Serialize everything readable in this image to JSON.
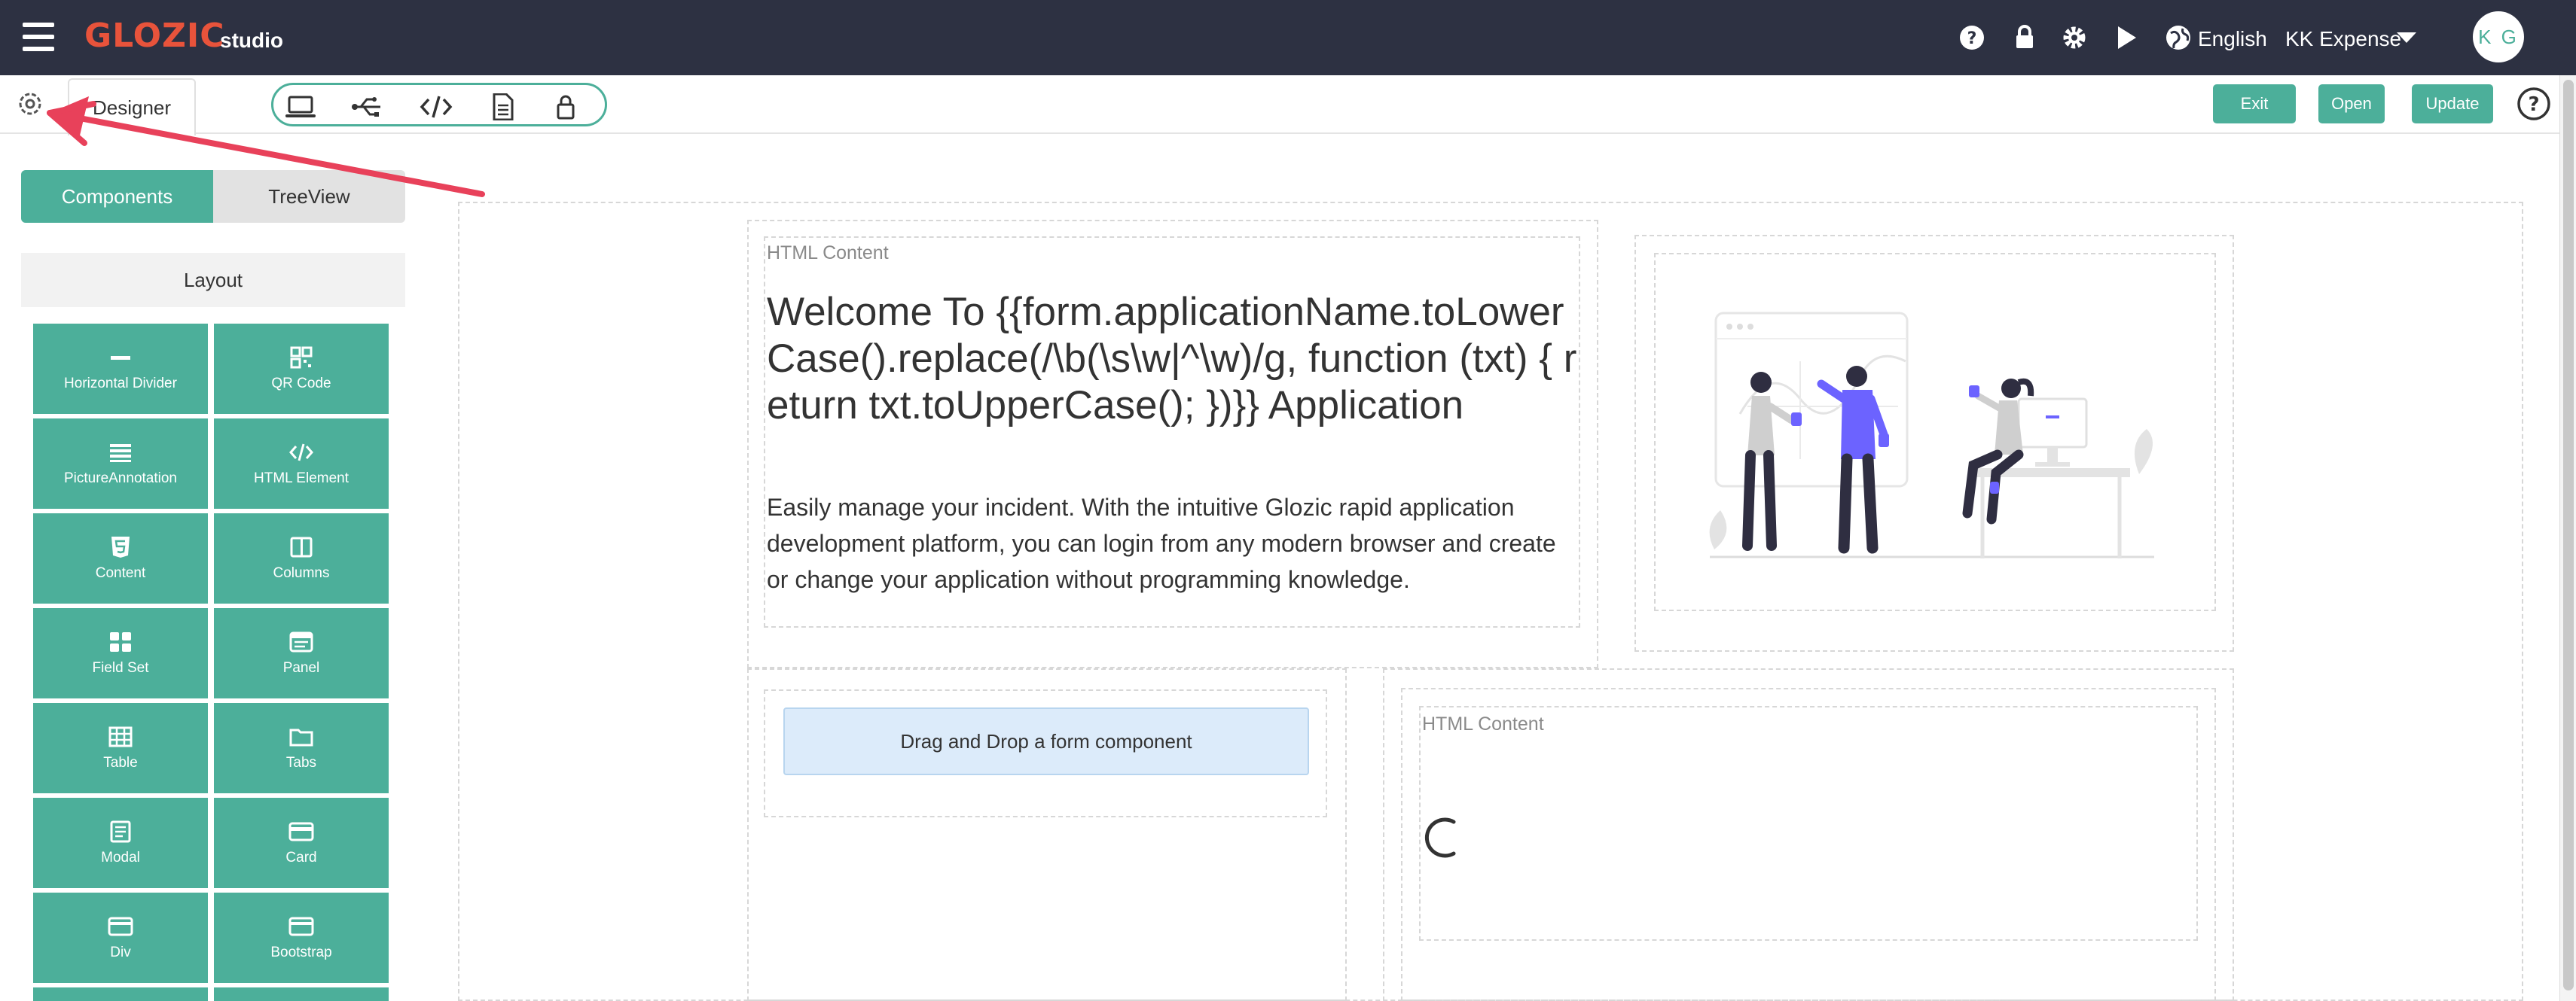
{
  "app": {
    "logo_text": "GLOZIC",
    "logo_sub": "studio",
    "language": "English",
    "application": "KK Expense",
    "user_initials": "K G"
  },
  "toolbar": {
    "designer_tab": "Designer",
    "exit_label": "Exit",
    "open_label": "Open",
    "update_label": "Update"
  },
  "left_panel": {
    "tabs": [
      "Components",
      "TreeView"
    ],
    "section_title": "Layout",
    "components": [
      {
        "label": "Horizontal Divider",
        "icon": "divider-icon"
      },
      {
        "label": "QR Code",
        "icon": "qr-code-icon"
      },
      {
        "label": "PictureAnnotation",
        "icon": "list-icon"
      },
      {
        "label": "HTML Element",
        "icon": "code-icon"
      },
      {
        "label": "Content",
        "icon": "html5-icon"
      },
      {
        "label": "Columns",
        "icon": "columns-icon"
      },
      {
        "label": "Field Set",
        "icon": "grid-icon"
      },
      {
        "label": "Panel",
        "icon": "panel-icon"
      },
      {
        "label": "Table",
        "icon": "table-icon"
      },
      {
        "label": "Tabs",
        "icon": "folder-icon"
      },
      {
        "label": "Modal",
        "icon": "modal-icon"
      },
      {
        "label": "Card",
        "icon": "card-icon"
      },
      {
        "label": "Div",
        "icon": "div-icon"
      },
      {
        "label": "Bootstrap",
        "icon": "bootstrap-icon"
      }
    ]
  },
  "canvas": {
    "html_content_label_1": "HTML Content",
    "welcome_text": "Welcome To {{form.applicationName.toLowerCase().replace(/\\b(\\s\\w|^\\w)/g, function (txt) { return txt.toUpperCase(); })}} Application",
    "description": "Easily manage your incident. With the intuitive Glozic rapid application development platform, you can login from any modern browser and create or change your application without programming knowledge.",
    "dropzone_text": "Drag and Drop a form component",
    "html_content_label_2": "HTML Content"
  },
  "colors": {
    "navbar": "#2d3142",
    "accent": "#4caf9a",
    "logo": "#e8533b",
    "annotation_arrow": "#e8415a"
  }
}
